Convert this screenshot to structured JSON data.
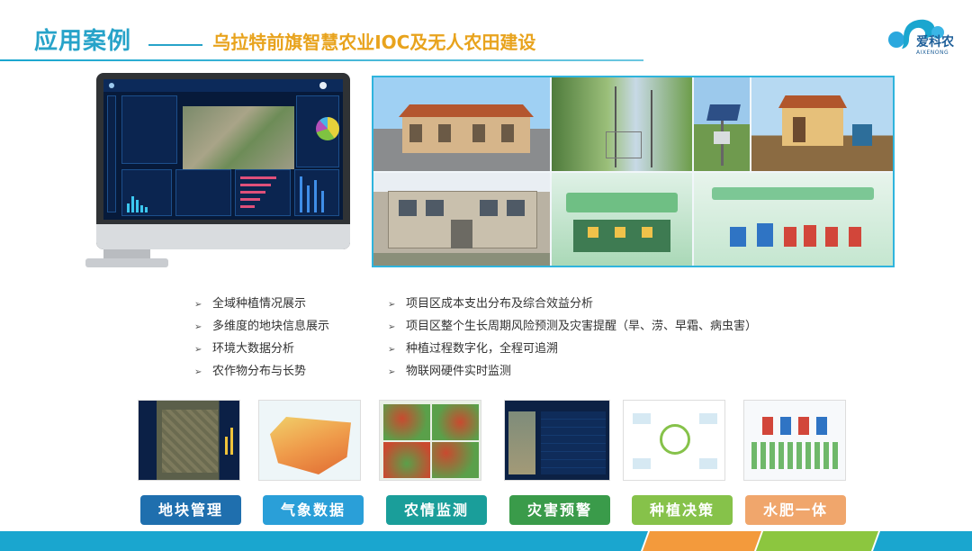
{
  "header": {
    "title": "应用案例",
    "subtitle": "乌拉特前旗智慧农业IOC及无人农田建设"
  },
  "logo": {
    "text": "爱科农",
    "subtext": "AIXENONG",
    "icon": "droplet-leaf-logo"
  },
  "features_left": [
    "全域种植情况展示",
    "多维度的地块信息展示",
    "环境大数据分析",
    "农作物分布与长势"
  ],
  "features_right": [
    "项目区成本支出分布及综合效益分析",
    "项目区整个生长周期风险预测及灾害提醒（旱、涝、早霜、病虫害）",
    "种植过程数字化，全程可追溯",
    "物联网硬件实时监测"
  ],
  "bullet_glyph": "➢",
  "modules": [
    {
      "label": "地块管理",
      "color": "#1f6fae"
    },
    {
      "label": "气象数据",
      "color": "#2a9fd8"
    },
    {
      "label": "农情监测",
      "color": "#1a9e9a"
    },
    {
      "label": "灾害预警",
      "color": "#3a9b4a"
    },
    {
      "label": "种植决策",
      "color": "#86c24a"
    },
    {
      "label": "水肥一体",
      "color": "#f0a66c"
    }
  ],
  "colors": {
    "accent": "#27a3c9",
    "subtitle": "#e8a31d"
  }
}
